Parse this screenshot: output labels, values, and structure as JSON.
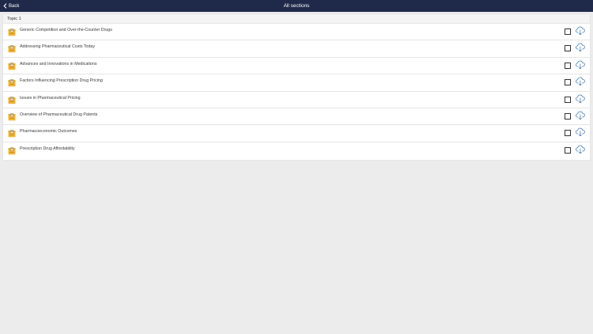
{
  "header": {
    "back_label": "Back",
    "title": "All sections"
  },
  "section": {
    "title": "Topic 1",
    "items": [
      {
        "label": "Generic Competition and Over-the-Counter Drugs"
      },
      {
        "label": "Addressing Pharmaceutical Costs Today"
      },
      {
        "label": "Advances and Innovations in Medications"
      },
      {
        "label": "Factors Influencing Prescription Drug Pricing"
      },
      {
        "label": "Issues in Pharmaceutical Pricing"
      },
      {
        "label": "Overview of Pharmaceutical Drug Patents"
      },
      {
        "label": "Pharmacoeconomic Outcomes"
      },
      {
        "label": "Prescription Drug Affordability"
      }
    ]
  },
  "icons": {
    "back": "chevron-left-icon",
    "document": "document-icon",
    "checkbox": "checkbox-icon",
    "download": "cloud-download-icon"
  },
  "colors": {
    "topbar": "#1f2a4a",
    "background": "#ececec",
    "panel": "#ffffff",
    "document_icon": "#f2b632",
    "download_icon": "#2b6fb6"
  }
}
